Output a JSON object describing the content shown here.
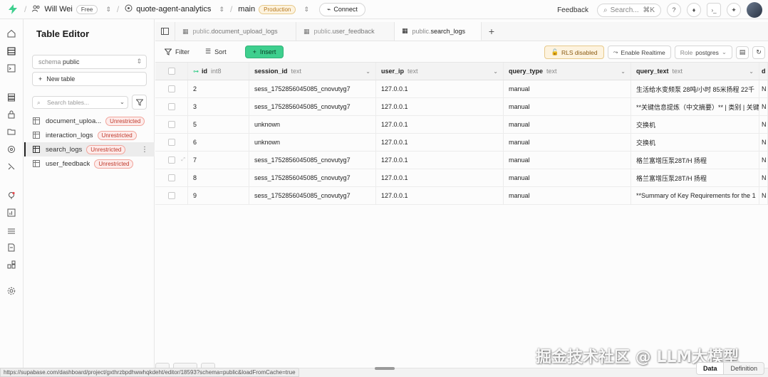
{
  "topbar": {
    "org_name": "Will Wei",
    "org_plan": "Free",
    "project_name": "quote-agent-analytics",
    "branch_name": "main",
    "branch_env": "Production",
    "connect_label": "Connect",
    "feedback_label": "Feedback",
    "search_placeholder": "Search...",
    "search_shortcut": "⌘K"
  },
  "sidebar": {
    "title": "Table Editor",
    "schema_label": "schema",
    "schema_value": "public",
    "new_table_label": "New table",
    "search_placeholder": "Search tables...",
    "tables": [
      {
        "name": "document_uploa...",
        "badge": "Unrestricted"
      },
      {
        "name": "interaction_logs",
        "badge": "Unrestricted"
      },
      {
        "name": "search_logs",
        "badge": "Unrestricted"
      },
      {
        "name": "user_feedback",
        "badge": "Unrestricted"
      }
    ]
  },
  "tabs": [
    {
      "prefix": "public.",
      "name": "document_upload_logs"
    },
    {
      "prefix": "public.",
      "name": "user_feedback"
    },
    {
      "prefix": "public.",
      "name": "search_logs"
    }
  ],
  "toolbar": {
    "filter_label": "Filter",
    "sort_label": "Sort",
    "insert_label": "Insert",
    "rls_label": "RLS disabled",
    "realtime_label": "Enable Realtime",
    "role_label": "Role",
    "role_value": "postgres"
  },
  "grid": {
    "columns": [
      {
        "name": "id",
        "type": "int8"
      },
      {
        "name": "session_id",
        "type": "text"
      },
      {
        "name": "user_ip",
        "type": "text"
      },
      {
        "name": "query_type",
        "type": "text"
      },
      {
        "name": "query_text",
        "type": "text"
      },
      {
        "name": "d",
        "type": ""
      }
    ],
    "rows": [
      {
        "id": "2",
        "session_id": "sess_1752856045085_cnovutyg7",
        "user_ip": "127.0.0.1",
        "query_type": "manual",
        "query_text": "生活给水变频泵 28吨/小时 85米扬程 22千",
        "extra": "N"
      },
      {
        "id": "3",
        "session_id": "sess_1752856045085_cnovutyg7",
        "user_ip": "127.0.0.1",
        "query_type": "manual",
        "query_text": "**关键信息提炼（中文摘要）** | 类别 | 关键",
        "extra": "N"
      },
      {
        "id": "5",
        "session_id": "unknown",
        "user_ip": "127.0.0.1",
        "query_type": "manual",
        "query_text": "交换机",
        "extra": "N"
      },
      {
        "id": "6",
        "session_id": "unknown",
        "user_ip": "127.0.0.1",
        "query_type": "manual",
        "query_text": "交换机",
        "extra": "N"
      },
      {
        "id": "7",
        "session_id": "sess_1752856045085_cnovutyg7",
        "user_ip": "127.0.0.1",
        "query_type": "manual",
        "query_text": "格兰富增压泵28T/H 扬程",
        "extra": "N"
      },
      {
        "id": "8",
        "session_id": "sess_1752856045085_cnovutyg7",
        "user_ip": "127.0.0.1",
        "query_type": "manual",
        "query_text": "格兰富增压泵28T/H 扬程",
        "extra": "N"
      },
      {
        "id": "9",
        "session_id": "sess_1752856045085_cnovutyg7",
        "user_ip": "127.0.0.1",
        "query_type": "manual",
        "query_text": "**Summary of Key Requirements for the 1",
        "extra": "N"
      }
    ]
  },
  "footer": {
    "status_url": "https://supabase.com/dashboard/project/gxthrzbpdhwwhqkdeht/editor/18593?schema=public&loadFromCache=true",
    "data_label": "Data",
    "definition_label": "Definition",
    "watermark": "掘金技术社区 @ LLM大模型"
  },
  "colors": {
    "brand_green": "#3ecf8e",
    "unrestricted_red": "#c0392b",
    "production_amber": "#b7791f"
  }
}
